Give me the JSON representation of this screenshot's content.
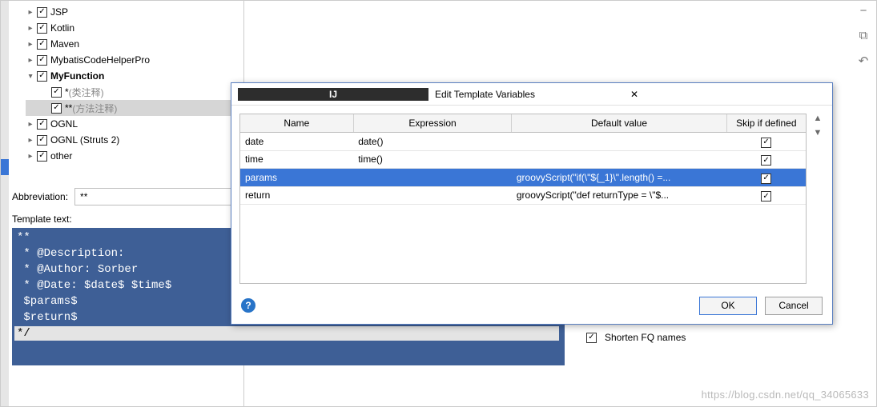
{
  "tree": {
    "items": [
      {
        "label": "JSP",
        "arrow": true,
        "open": false,
        "checked": true,
        "indent": 0
      },
      {
        "label": "Kotlin",
        "arrow": true,
        "open": false,
        "checked": true,
        "indent": 0
      },
      {
        "label": "Maven",
        "arrow": true,
        "open": false,
        "checked": true,
        "indent": 0
      },
      {
        "label": "MybatisCodeHelperPro",
        "arrow": true,
        "open": false,
        "checked": true,
        "indent": 0
      },
      {
        "label": "MyFunction",
        "arrow": true,
        "open": true,
        "checked": true,
        "indent": 0,
        "bold": true
      },
      {
        "label": "*",
        "note": "(类注释)",
        "arrow": false,
        "checked": true,
        "indent": 1
      },
      {
        "label": "**",
        "note": "(方法注释)",
        "arrow": false,
        "checked": true,
        "indent": 1,
        "selected": true
      },
      {
        "label": "OGNL",
        "arrow": true,
        "open": false,
        "checked": true,
        "indent": 0
      },
      {
        "label": "OGNL (Struts 2)",
        "arrow": true,
        "open": false,
        "checked": true,
        "indent": 0
      },
      {
        "label": "other",
        "arrow": true,
        "open": false,
        "checked": true,
        "indent": 0
      }
    ]
  },
  "form": {
    "abbreviation_label": "Abbreviation:",
    "abbreviation_value": "**",
    "template_text_label": "Template text:",
    "template_lines": [
      "**",
      " * @Description:",
      " * @Author: Sorber",
      " * @Date: $date$ $time$",
      " $params$",
      " $return$"
    ],
    "template_last_prefix": " */"
  },
  "options": {
    "opt1_label": "Shorten FQ names"
  },
  "dialog": {
    "title": "Edit Template Variables",
    "headers": {
      "name": "Name",
      "expression": "Expression",
      "default": "Default value",
      "skip": "Skip if defined"
    },
    "rows": [
      {
        "name": "date",
        "expr": "date()",
        "def": "",
        "skip": true
      },
      {
        "name": "time",
        "expr": "time()",
        "def": "",
        "skip": true
      },
      {
        "name": "params",
        "expr": "",
        "def": "groovyScript(\"if(\\\"${_1}\\\".length() =...",
        "skip": true,
        "selected": true
      },
      {
        "name": "return",
        "expr": "",
        "def": "groovyScript(\"def returnType = \\\"$...",
        "skip": true
      }
    ],
    "ok_label": "OK",
    "cancel_label": "Cancel"
  },
  "watermark": "https://blog.csdn.net/qq_34065633"
}
